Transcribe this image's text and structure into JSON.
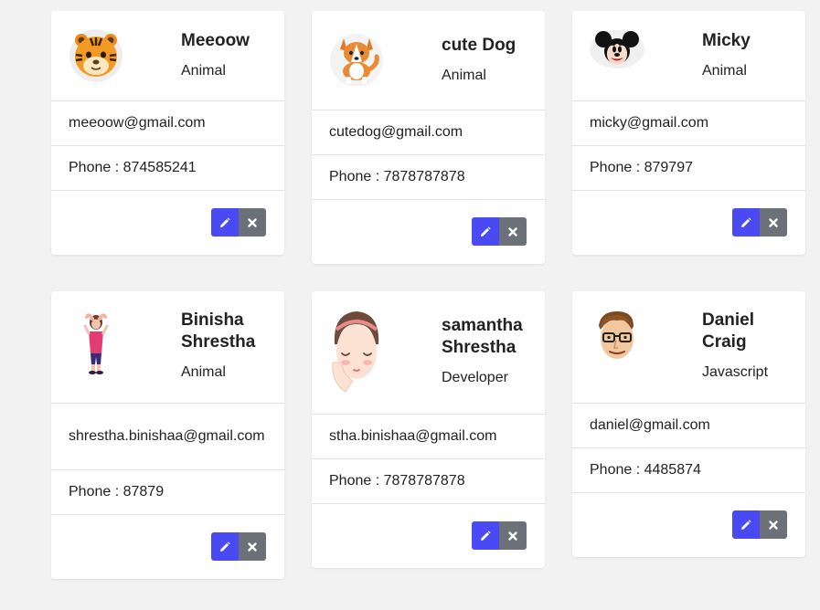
{
  "contacts": [
    {
      "name": "Meeoow",
      "role": "Animal",
      "email": "meeoow@gmail.com",
      "phone": "Phone : 874585241",
      "avatar_icon": "tiger-avatar-icon"
    },
    {
      "name": "cute Dog",
      "role": "Animal",
      "email": "cutedog@gmail.com",
      "phone": "Phone : 7878787878",
      "avatar_icon": "dog-avatar-icon"
    },
    {
      "name": "Micky",
      "role": "Animal",
      "email": "micky@gmail.com",
      "phone": "Phone : 879797",
      "avatar_icon": "mickey-avatar-icon"
    },
    {
      "name": "Binisha Shrestha",
      "role": "Animal",
      "email": "shrestha.binishaa@gmail.com",
      "phone": "Phone : 87879",
      "avatar_icon": "woman-avatar-icon"
    },
    {
      "name": "samantha Shrestha",
      "role": "Developer",
      "email": "stha.binishaa@gmail.com",
      "phone": "Phone : 7878787878",
      "avatar_icon": "girl-face-avatar-icon"
    },
    {
      "name": "Daniel Craig",
      "role": "Javascript",
      "email": "daniel@gmail.com",
      "phone": "Phone : 4485874",
      "avatar_icon": "man-glasses-avatar-icon"
    }
  ],
  "actions": {
    "edit_icon": "pencil-icon",
    "delete_icon": "close-icon"
  },
  "colors": {
    "edit": "#4a4af4",
    "delete": "#6b7079",
    "background": "#f2f2f2"
  }
}
